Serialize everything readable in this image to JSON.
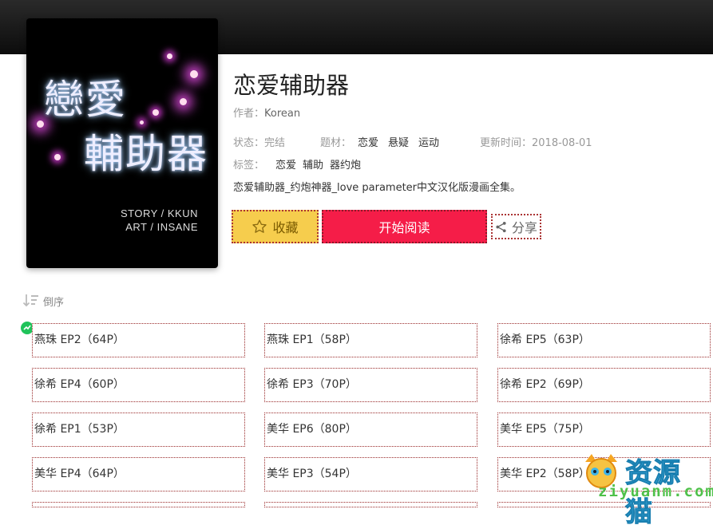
{
  "cover": {
    "title_line1": "戀愛",
    "title_line2": "輔助器",
    "credit_story": "STORY / KKUN",
    "credit_art": "ART / INSANE"
  },
  "comic": {
    "title": "恋爱辅助器",
    "author_label": "作者：",
    "author": "Korean",
    "status_label": "状态：",
    "status": "完结",
    "genre_label": "题材：",
    "genres": [
      "恋爱",
      "悬疑",
      "运动"
    ],
    "updated_label": "更新时间：",
    "updated": "2018-08-01",
    "tags_label": "标签：",
    "tags": [
      "恋爱",
      "辅助",
      "器约炮"
    ],
    "description": "恋爱辅助器_约炮神器_love parameter中文汉化版漫画全集。"
  },
  "actions": {
    "favorite": "收藏",
    "read": "开始阅读",
    "share": "分享"
  },
  "sort_label": "倒序",
  "episodes": [
    "燕珠 EP2（64P）",
    "燕珠 EP1（58P）",
    "徐希 EP5（63P）",
    "徐希 EP4（60P）",
    "徐希 EP3（70P）",
    "徐希 EP2（69P）",
    "徐希 EP1（53P）",
    "美华 EP6（80P）",
    "美华 EP5（75P）",
    "美华 EP4（64P）",
    "美华 EP3（54P）",
    "美华 EP2（58P）"
  ],
  "watermark": {
    "cn": "资源猫",
    "en": "ziyuanm.com"
  },
  "colors": {
    "favorite_bg": "#f6cd4d",
    "read_bg": "#f51d48",
    "new_badge": "#1fc35a"
  }
}
